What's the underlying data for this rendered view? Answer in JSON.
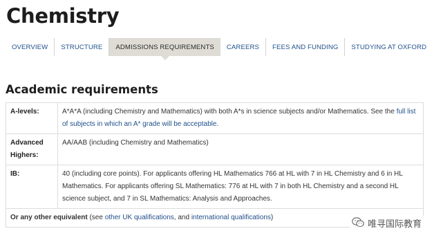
{
  "page": {
    "title": "Chemistry"
  },
  "tabs": [
    {
      "label": "OVERVIEW"
    },
    {
      "label": "STRUCTURE"
    },
    {
      "label": "ADMISSIONS REQUIREMENTS"
    },
    {
      "label": "CAREERS"
    },
    {
      "label": "FEES AND FUNDING"
    },
    {
      "label": "STUDYING AT OXFORD"
    }
  ],
  "active_tab": "ADMISSIONS REQUIREMENTS",
  "section": {
    "heading": "Academic requirements"
  },
  "requirements": {
    "alevels": {
      "label": "A-levels:",
      "text_1": "A*A*A (including Chemistry and Mathematics) with both A*s in science subjects and/or Mathematics. See the ",
      "link": "full list of subjects in which an A* grade will be acceptable",
      "text_2": "."
    },
    "advanced_highers": {
      "label": "Advanced Highers:",
      "text": "AA/AAB (including Chemistry and Mathematics)"
    },
    "ib": {
      "label": "IB:",
      "text": "40 (including core points). For applicants offering HL Mathematics 766 at HL with 7 in HL Chemistry and 6 in HL Mathematics. For applicants offering SL Mathematics: 776 at HL with 7 in both HL Chemistry and a second HL science subject, and 7 in SL Mathematics: Analysis and Approaches."
    },
    "other": {
      "bold": "Or any other equivalent",
      "text_1": " (see ",
      "link_1": "other UK qualifications",
      "text_2": ", and ",
      "link_2": "international qualifications",
      "text_3": ")"
    }
  },
  "watermark": {
    "text": "唯寻国际教育",
    "icon": "wechat-icon"
  },
  "colors": {
    "link": "#1f4f8a",
    "active_tab_bg": "#dedcd5",
    "border": "#dcdcdc"
  }
}
